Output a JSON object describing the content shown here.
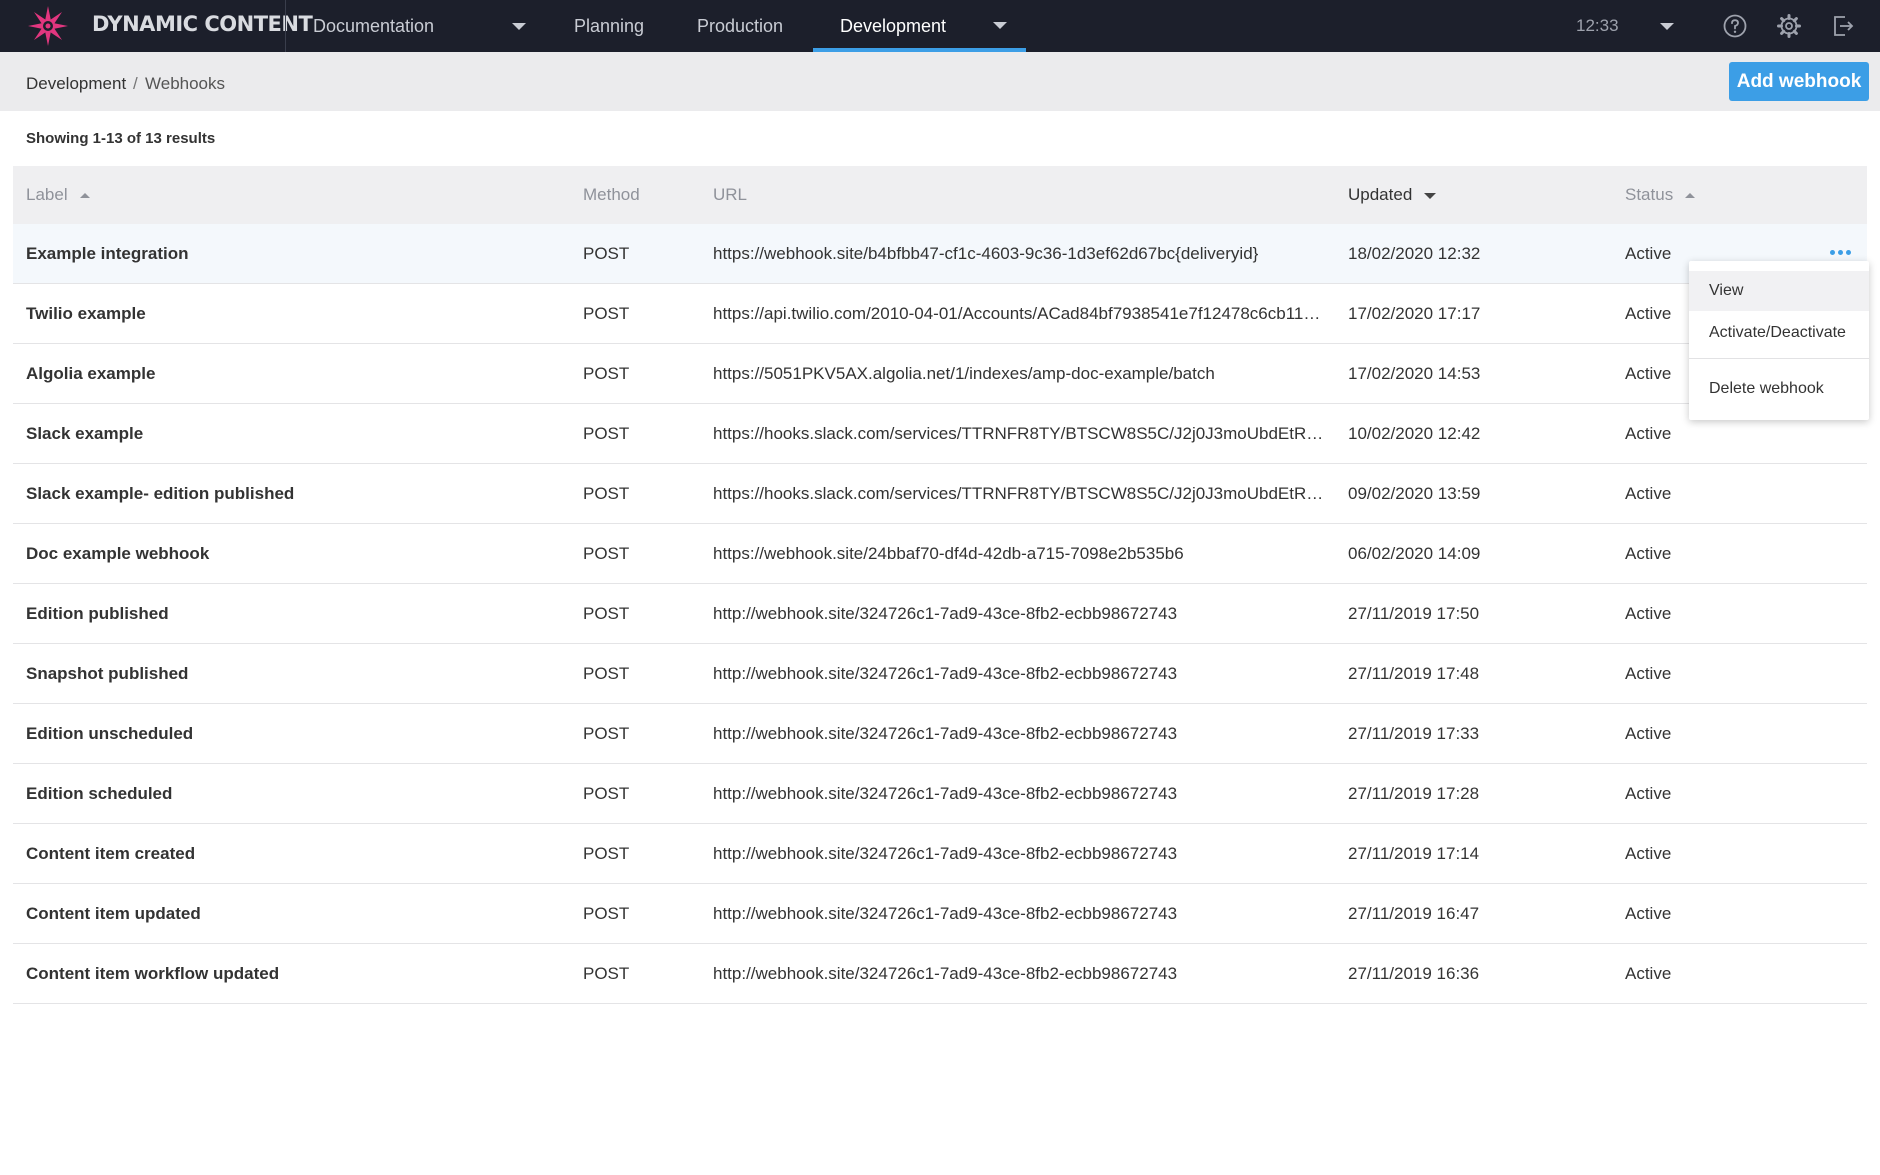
{
  "app": {
    "title": "DYNAMIC CONTENT",
    "time": "12:33"
  },
  "nav": {
    "hub": "Documentation",
    "tabs": [
      "Planning",
      "Production",
      "Development"
    ],
    "active_tab": "Development"
  },
  "breadcrumb": {
    "parent": "Development",
    "separator": "/",
    "current": "Webhooks"
  },
  "actions": {
    "add_webhook": "Add webhook"
  },
  "results_summary": "Showing 1-13 of 13 results",
  "table": {
    "headers": {
      "label": "Label",
      "method": "Method",
      "url": "URL",
      "updated": "Updated",
      "status": "Status"
    },
    "rows": [
      {
        "label": "Example integration",
        "method": "POST",
        "url": "https://webhook.site/b4bfbb47-cf1c-4603-9c36-1d3ef62d67bc{deliveryid}",
        "updated": "18/02/2020 12:32",
        "status": "Active"
      },
      {
        "label": "Twilio example",
        "method": "POST",
        "url": "https://api.twilio.com/2010-04-01/Accounts/ACad84bf7938541e7f12478c6cb11…",
        "updated": "17/02/2020 17:17",
        "status": "Active"
      },
      {
        "label": "Algolia example",
        "method": "POST",
        "url": "https://5051PKV5AX.algolia.net/1/indexes/amp-doc-example/batch",
        "updated": "17/02/2020 14:53",
        "status": "Active"
      },
      {
        "label": "Slack example",
        "method": "POST",
        "url": "https://hooks.slack.com/services/TTRNFR8TY/BTSCW8S5C/J2j0J3moUbdEtRm…",
        "updated": "10/02/2020 12:42",
        "status": "Active"
      },
      {
        "label": "Slack example- edition published",
        "method": "POST",
        "url": "https://hooks.slack.com/services/TTRNFR8TY/BTSCW8S5C/J2j0J3moUbdEtRm…",
        "updated": "09/02/2020 13:59",
        "status": "Active"
      },
      {
        "label": "Doc example webhook",
        "method": "POST",
        "url": "https://webhook.site/24bbaf70-df4d-42db-a715-7098e2b535b6",
        "updated": "06/02/2020 14:09",
        "status": "Active"
      },
      {
        "label": "Edition published",
        "method": "POST",
        "url": "http://webhook.site/324726c1-7ad9-43ce-8fb2-ecbb98672743",
        "updated": "27/11/2019 17:50",
        "status": "Active"
      },
      {
        "label": "Snapshot published",
        "method": "POST",
        "url": "http://webhook.site/324726c1-7ad9-43ce-8fb2-ecbb98672743",
        "updated": "27/11/2019 17:48",
        "status": "Active"
      },
      {
        "label": "Edition unscheduled",
        "method": "POST",
        "url": "http://webhook.site/324726c1-7ad9-43ce-8fb2-ecbb98672743",
        "updated": "27/11/2019 17:33",
        "status": "Active"
      },
      {
        "label": "Edition scheduled",
        "method": "POST",
        "url": "http://webhook.site/324726c1-7ad9-43ce-8fb2-ecbb98672743",
        "updated": "27/11/2019 17:28",
        "status": "Active"
      },
      {
        "label": "Content item created",
        "method": "POST",
        "url": "http://webhook.site/324726c1-7ad9-43ce-8fb2-ecbb98672743",
        "updated": "27/11/2019 17:14",
        "status": "Active"
      },
      {
        "label": "Content item updated",
        "method": "POST",
        "url": "http://webhook.site/324726c1-7ad9-43ce-8fb2-ecbb98672743",
        "updated": "27/11/2019 16:47",
        "status": "Active"
      },
      {
        "label": "Content item workflow updated",
        "method": "POST",
        "url": "http://webhook.site/324726c1-7ad9-43ce-8fb2-ecbb98672743",
        "updated": "27/11/2019 16:36",
        "status": "Active"
      }
    ]
  },
  "row_menu": {
    "items": [
      "View",
      "Activate/Deactivate",
      "Delete webhook"
    ],
    "highlighted": "View"
  },
  "colors": {
    "topbar": "#1c1f2b",
    "accent": "#3c9ee6",
    "subbar": "#ebebed",
    "logo": "#e2367f"
  },
  "icons": [
    "help-icon",
    "settings-gear-icon",
    "logout-icon",
    "more-options-icon"
  ]
}
